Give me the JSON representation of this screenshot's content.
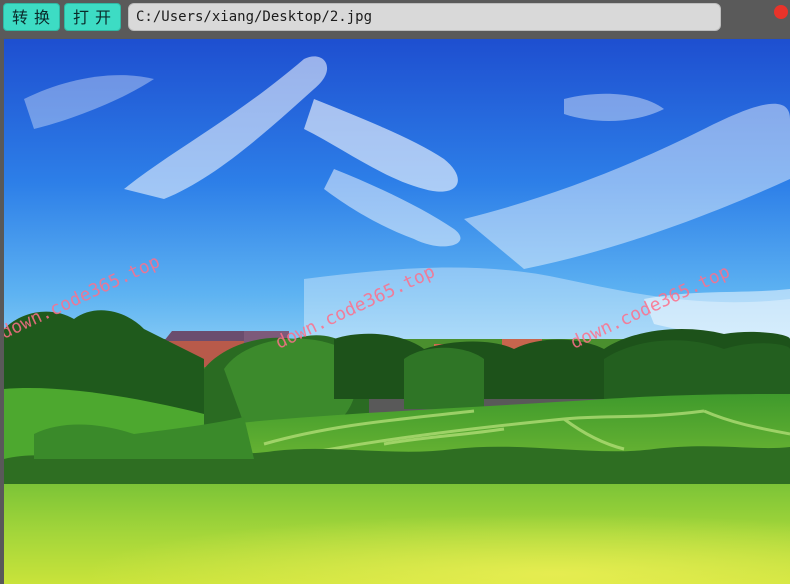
{
  "toolbar": {
    "convert_label": "转换",
    "open_label": "打开",
    "path_value": "C:/Users/xiang/Desktop/2.jpg"
  },
  "image": {
    "watermark_text": "down.code365.top",
    "scene": "landscape-photo"
  },
  "colors": {
    "button_accent": "#3ddcc4",
    "close_button": "#e8332a",
    "watermark": "#ff6f8a"
  }
}
